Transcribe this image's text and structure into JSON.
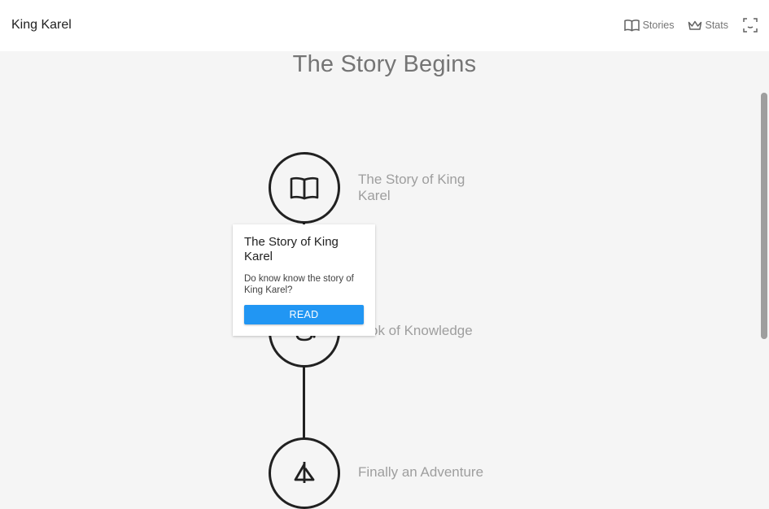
{
  "app": {
    "title": "King Karel"
  },
  "nav": {
    "stories_label": "Stories",
    "stats_label": "Stats"
  },
  "page": {
    "title": "The Story Begins"
  },
  "stories": [
    {
      "label": "The Story of King Karel",
      "icon": "book-icon"
    },
    {
      "label": "ok of Knowledge",
      "icon": "knowledge-icon"
    },
    {
      "label": "Finally an Adventure",
      "icon": "sailboat-icon"
    }
  ],
  "popup": {
    "title": "The Story of King Karel",
    "description": "Do know know the story of King Karel?",
    "button_label": "READ"
  },
  "colors": {
    "accent": "#2196f3",
    "node_border": "#212121",
    "label": "#9e9e9e"
  }
}
